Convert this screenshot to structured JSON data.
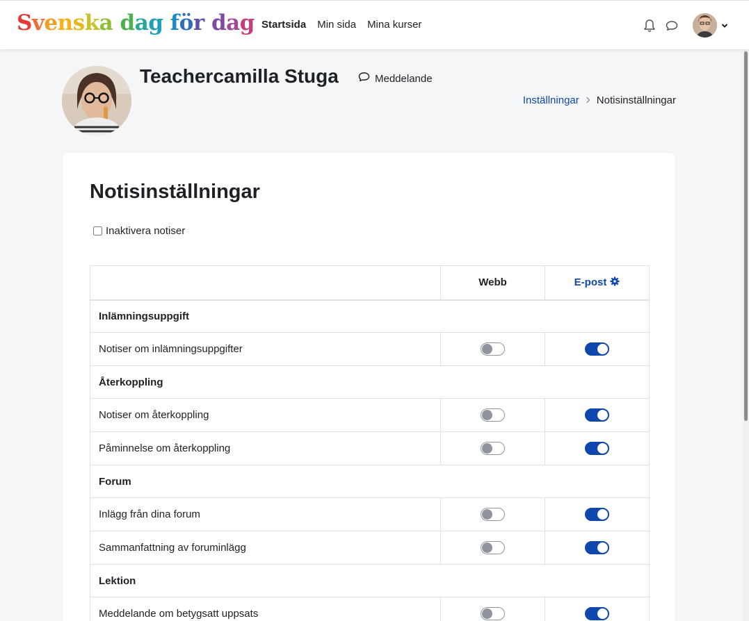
{
  "site": {
    "logo_letters": [
      {
        "ch": "S",
        "color": "#e53935"
      },
      {
        "ch": "v",
        "color": "#ef6c35"
      },
      {
        "ch": "e",
        "color": "#f39c1f"
      },
      {
        "ch": "n",
        "color": "#f5b21b"
      },
      {
        "ch": "s",
        "color": "#e9b818"
      },
      {
        "ch": "k",
        "color": "#c9c22a"
      },
      {
        "ch": "a",
        "color": "#8fbf3a"
      },
      {
        "ch": " ",
        "color": "#ffffff"
      },
      {
        "ch": "d",
        "color": "#4caf50"
      },
      {
        "ch": "a",
        "color": "#26a69a"
      },
      {
        "ch": "g",
        "color": "#1e9fb8"
      },
      {
        "ch": " ",
        "color": "#ffffff"
      },
      {
        "ch": "f",
        "color": "#1e88c8"
      },
      {
        "ch": "ö",
        "color": "#2f6fbe"
      },
      {
        "ch": "r",
        "color": "#5a56b0"
      },
      {
        "ch": " ",
        "color": "#ffffff"
      },
      {
        "ch": "d",
        "color": "#7e4aa6"
      },
      {
        "ch": "a",
        "color": "#a34797"
      },
      {
        "ch": "g",
        "color": "#c2407c"
      }
    ]
  },
  "nav": {
    "home": "Startsida",
    "dashboard": "Min sida",
    "courses": "Mina kurser"
  },
  "icons": {
    "notifications": "bell-icon",
    "messages": "chat-icon",
    "user_menu": "chevron-down-icon",
    "message_button": "chat-icon",
    "email_settings": "gear-icon"
  },
  "profile": {
    "name": "Teachercamilla Stuga",
    "message_label": "Meddelande"
  },
  "breadcrumb": {
    "settings": "Inställningar",
    "current": "Notisinställningar"
  },
  "page": {
    "title": "Notisinställningar",
    "disable_label": "Inaktivera notiser",
    "disable_checked": false
  },
  "table": {
    "col_web": "Webb",
    "col_email": "E-post",
    "groups": [
      {
        "name": "Inlämningsuppgift",
        "items": [
          {
            "label": "Notiser om inlämningsuppgifter",
            "web": false,
            "email": true
          }
        ]
      },
      {
        "name": "Återkoppling",
        "items": [
          {
            "label": "Notiser om återkoppling",
            "web": false,
            "email": true
          },
          {
            "label": "Påminnelse om återkoppling",
            "web": false,
            "email": true
          }
        ]
      },
      {
        "name": "Forum",
        "items": [
          {
            "label": "Inlägg från dina forum",
            "web": false,
            "email": true
          },
          {
            "label": "Sammanfattning av foruminlägg",
            "web": false,
            "email": true
          }
        ]
      },
      {
        "name": "Lektion",
        "items": [
          {
            "label": "Meddelande om betygsatt uppsats",
            "web": false,
            "email": true
          }
        ]
      }
    ]
  },
  "colors": {
    "accent": "#0f47ad",
    "toggle_off": "#8f959e"
  }
}
